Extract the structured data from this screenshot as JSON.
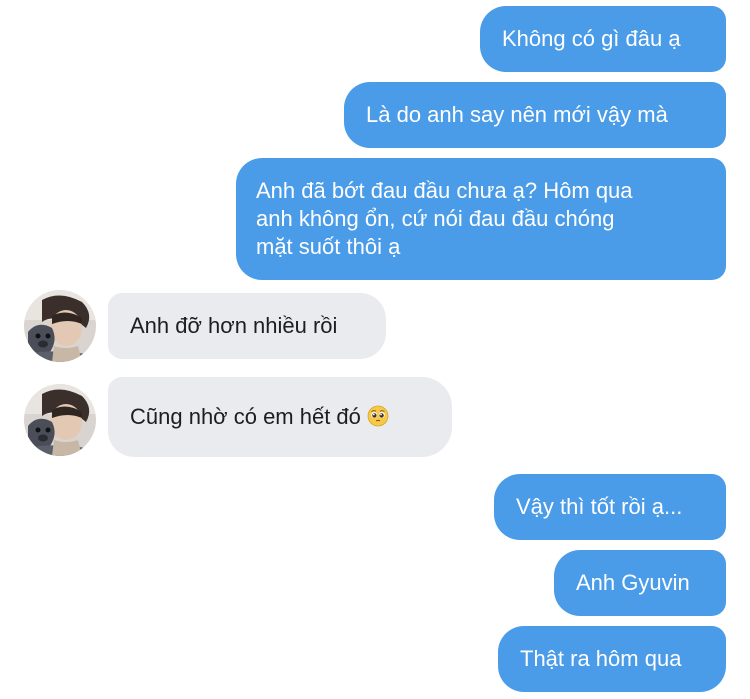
{
  "messages": {
    "m1": "Không có gì đâu ạ",
    "m2": "Là do anh say nên mới vậy mà",
    "m3_line1": "Anh đã bớt đau đầu chưa ạ? Hôm qua",
    "m3_line2": "anh không ổn, cứ nói đau đầu chóng",
    "m3_line3": "mặt suốt thôi ạ",
    "m4": "Anh đỡ hơn nhiều rồi",
    "m5": "Cũng nhờ có em hết đó",
    "m6": "Vậy thì tốt rồi ạ...",
    "m7": "Anh Gyuvin",
    "m8": "Thật ra hôm qua"
  },
  "icons": {
    "emoji": "pleading-face-emoji",
    "avatar": "contact-avatar-photo"
  },
  "colors": {
    "outgoing_bubble": "#4a9be8",
    "incoming_bubble": "#e9ebee",
    "outgoing_text": "#ffffff",
    "incoming_text": "#1c1e21"
  }
}
